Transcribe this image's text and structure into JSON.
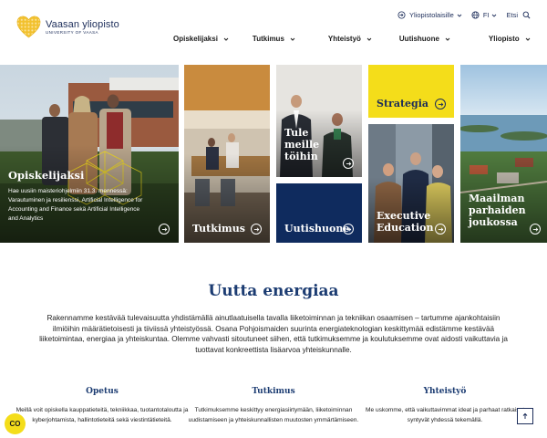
{
  "logo": {
    "name": "Vaasan yliopisto",
    "subtitle": "UNIVERSITY OF VAASA"
  },
  "utility": {
    "audience_label": "Yliopistolaisille",
    "language_label": "FI",
    "search_label": "Etsi"
  },
  "nav": {
    "items": [
      {
        "label": "Opiskelijaksi"
      },
      {
        "label": "Tutkimus"
      },
      {
        "label": "Yhteistyö"
      },
      {
        "label": "Uutishuone"
      },
      {
        "label": "Yliopisto"
      }
    ]
  },
  "tiles": {
    "opiskelijaksi": {
      "title": "Opiskelijaksi",
      "body": "Hae uusiin maisteriohjelmiin 31.3. mennessä: Varautuminen ja resilienssi, Artificial Intelligence for Accounting and Finance sekä Artificial Intelligence and Analytics"
    },
    "tutkimus": {
      "title": "Tutkimus"
    },
    "tule_meille": {
      "line1": "Tule",
      "line2": "meille",
      "line3": "töihin"
    },
    "uutishuone": {
      "title": "Uutishuone"
    },
    "strategia": {
      "title": "Strategia"
    },
    "executive": {
      "line1": "Executive",
      "line2": "Education"
    },
    "maailman": {
      "line1": "Maailman",
      "line2": "parhaiden",
      "line3": "joukossa"
    }
  },
  "section": {
    "title": "Uutta energiaa",
    "body": "Rakennamme kestävää tulevaisuutta yhdistämällä ainutlaatuisella tavalla liiketoiminnan ja tekniikan osaamisen – tartumme ajankohtaisiin ilmiöihin määrätietoisesti ja tiiviissä yhteistyössä. Osana Pohjoismaiden suurinta energiateknologian keskittymää edistämme kestävää liiketoimintaa, energiaa ja yhteiskuntaa. Olemme vahvasti sitoutuneet siihen, että tutkimuksemme ja koulutuksemme ovat aidosti vaikuttavia ja tuottavat konkreettista lisäarvoa yhteiskunnalle."
  },
  "columns": [
    {
      "title": "Opetus",
      "body": "Meillä voit opiskella kauppatieteitä, tekniikkaa, tuotantotaloutta ja kyberjohtamista, hallintotieteitä sekä viestintätieteitä."
    },
    {
      "title": "Tutkimus",
      "body": "Tutkimuksemme keskittyy energiasiirtymään, liiketoiminnan uudistamiseen ja yhteiskunnallisten muutosten ymmärtämiseen."
    },
    {
      "title": "Yhteistyö",
      "body": "Me uskomme, että vaikuttavimmat ideat ja parhaat ratkaisut syntyvät yhdessä tekemällä."
    }
  ],
  "cookie": {
    "label": "CO"
  },
  "colors": {
    "navy": "#1c2d5a",
    "brand_blue": "#1c3c72",
    "yellow": "#f4dd1a",
    "logo_gold": "#f2c12e",
    "news_navy": "#0f2b5e"
  },
  "icons": [
    "heart-logo-icon",
    "login-icon",
    "globe-icon",
    "search-icon",
    "chevron-down-icon",
    "arrow-right-icon",
    "arrow-up-icon"
  ]
}
